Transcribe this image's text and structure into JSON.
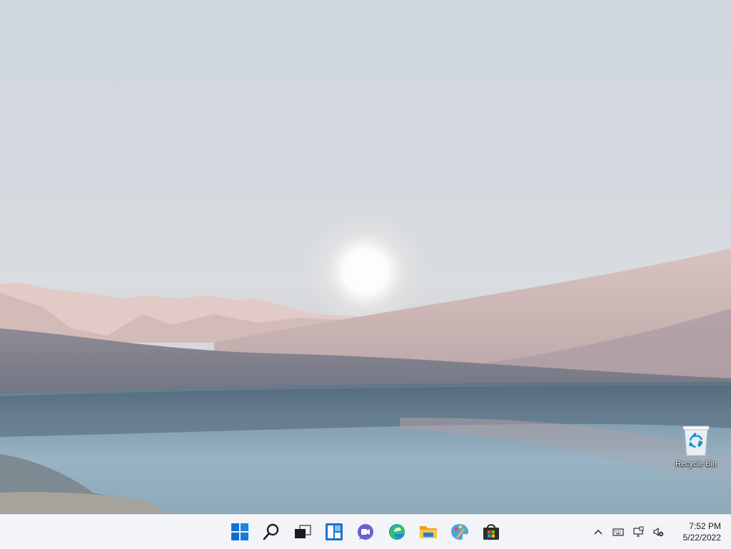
{
  "desktop": {
    "icons": [
      {
        "label": "Recycle Bin",
        "icon": "recycle-bin-icon"
      }
    ]
  },
  "taskbar": {
    "apps": [
      {
        "name": "start",
        "icon": "windows-start-icon"
      },
      {
        "name": "search",
        "icon": "search-icon"
      },
      {
        "name": "task-view",
        "icon": "task-view-icon"
      },
      {
        "name": "widgets",
        "icon": "widgets-icon"
      },
      {
        "name": "chat",
        "icon": "teams-chat-icon"
      },
      {
        "name": "edge",
        "icon": "edge-browser-icon"
      },
      {
        "name": "file-explorer",
        "icon": "file-explorer-icon"
      },
      {
        "name": "paint",
        "icon": "paint-icon"
      },
      {
        "name": "store",
        "icon": "microsoft-store-icon"
      }
    ],
    "tray": {
      "icons": [
        "chevron-up-icon",
        "keyboard-icon",
        "network-icon",
        "volume-muted-icon"
      ],
      "time": "7:52 PM",
      "date": "5/22/2022"
    }
  }
}
